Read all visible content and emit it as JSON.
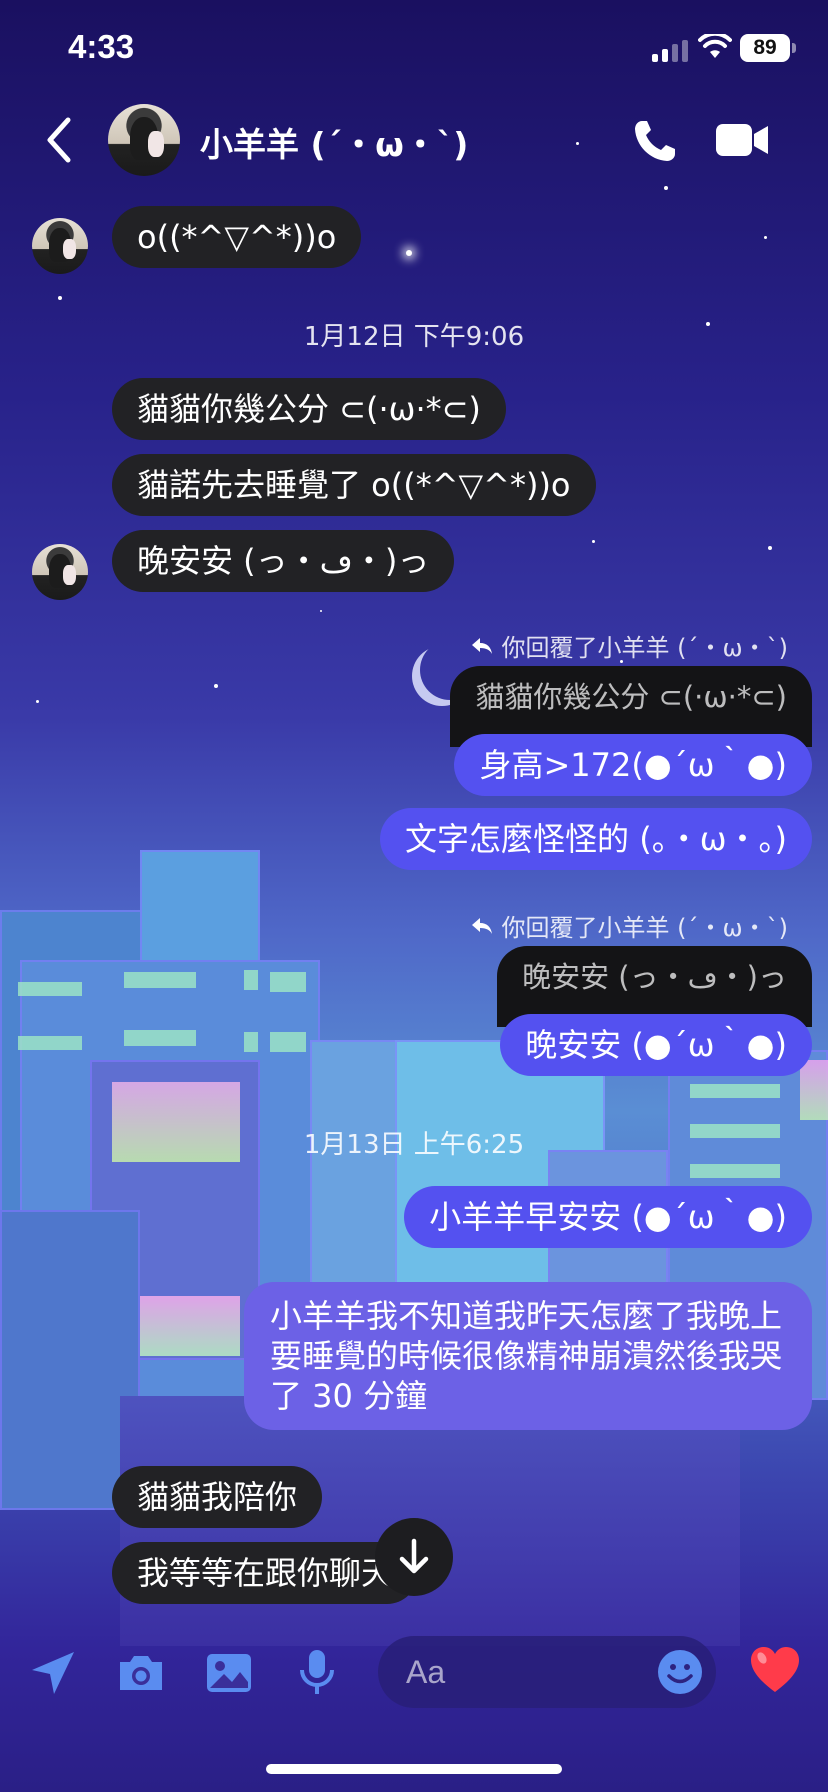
{
  "status_bar": {
    "time": "4:33",
    "battery": "89"
  },
  "header": {
    "contact_name": "小羊羊 (´・ω・`)",
    "icons": {
      "back": "chevron-left-icon",
      "call": "phone-icon",
      "video": "video-camera-icon"
    }
  },
  "messages": {
    "m1": "o((*^▽^*))o",
    "ts1": "1月12日 下午9:06",
    "m2": "貓貓你幾公分 ⊂(·ω·*⊂)",
    "m3": "貓諾先去睡覺了 o((*^▽^*))o",
    "m4": "晚安安 (っ・ڡ・)っ",
    "reply1_meta": "你回覆了小羊羊 (´・ω・`)",
    "reply1_quote": "貓貓你幾公分 ⊂(·ω·*⊂)",
    "reply1_text": "身高>172(●´ω｀●)",
    "m5": "文字怎麼怪怪的 (。・ω・。)",
    "reply2_meta": "你回覆了小羊羊 (´・ω・`)",
    "reply2_quote": "晚安安 (っ・ڡ・)っ",
    "reply2_text": "晚安安 (●´ω｀●)",
    "ts2": "1月13日 上午6:25",
    "m6": "小羊羊早安安 (●´ω｀●)",
    "m7": "小羊羊我不知道我昨天怎麼了我晚上要睡覺的時候很像精神崩潰然後我哭了 30 分鐘",
    "m8": "貓貓我陪你",
    "m9": "我等等在跟你聊天"
  },
  "composer": {
    "placeholder": "Aa",
    "icons": [
      "location-arrow-icon",
      "camera-icon",
      "image-icon",
      "microphone-icon",
      "emoji-icon",
      "heart-icon"
    ]
  },
  "colors": {
    "outgoing": "#5451f0",
    "incoming": "#222225",
    "heart": "#ff3b4a"
  }
}
